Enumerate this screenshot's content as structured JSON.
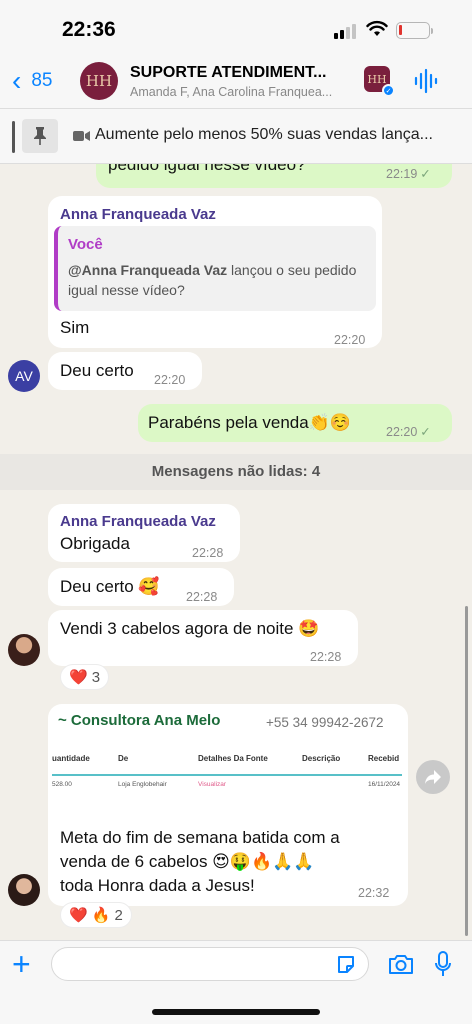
{
  "status_bar": {
    "time": "22:36"
  },
  "header": {
    "back_count": "85",
    "group_initials": "HH",
    "title": "SUPORTE ATENDIMENT...",
    "subtitle": "Amanda F, Ana Carolina Franquea..."
  },
  "pinned": {
    "text": "Aumente pelo menos 50% suas vendas lança..."
  },
  "messages": {
    "m0": {
      "text": "pedido igual nesse vídeo?",
      "time": "22:19"
    },
    "m1": {
      "sender": "Anna Franqueada Vaz",
      "quote_author": "Você",
      "quote_mention": "@Anna Franqueada Vaz",
      "quote_text": " lançou o seu pedido igual nesse vídeo?",
      "text": "Sim",
      "time": "22:20"
    },
    "m2": {
      "avatar_initials": "AV",
      "text": "Deu certo",
      "time": "22:20"
    },
    "m3": {
      "text": "Parabéns pela venda👏☺️",
      "time": "22:20"
    },
    "unread_label": "Mensagens não lidas: 4",
    "m4": {
      "sender": "Anna Franqueada Vaz",
      "text": "Obrigada",
      "time": "22:28"
    },
    "m5": {
      "text": "Deu certo 🥰",
      "time": "22:28"
    },
    "m6": {
      "text": "Vendi 3 cabelos agora de noite 🤩",
      "time": "22:28",
      "reaction_emoji": "❤️",
      "reaction_count": "3"
    },
    "m7": {
      "sender": "~ Consultora Ana Melo",
      "phone": "+55 34 99942-2672",
      "table_headers": [
        "uantidade",
        "De",
        "Detalhes Da Fonte",
        "Descrição",
        "Recebid"
      ],
      "table_cells": [
        "528.00",
        "Loja Englobehair",
        "Visualizar",
        "",
        "16/11/2024"
      ],
      "text_line1": "Meta do fim de semana batida com a",
      "text_line2": "venda de 6 cabelos 😍🤑🔥🙏🙏",
      "text_line3": "toda Honra dada a Jesus!",
      "time": "22:32",
      "reaction_emojis": "❤️ 🔥",
      "reaction_count": "2"
    }
  },
  "colors": {
    "accent": "#0a84ff",
    "outgoing": "#dcf8c6",
    "sender_purple": "#4a3a8e",
    "quote_magenta": "#b03cc6",
    "ana_green": "#1c6b3a"
  },
  "icons": [
    "back-chevron-icon",
    "audio-wave-icon",
    "pin-icon",
    "video-camera-icon",
    "plus-icon",
    "sticker-icon",
    "camera-icon",
    "microphone-icon",
    "forward-icon"
  ]
}
